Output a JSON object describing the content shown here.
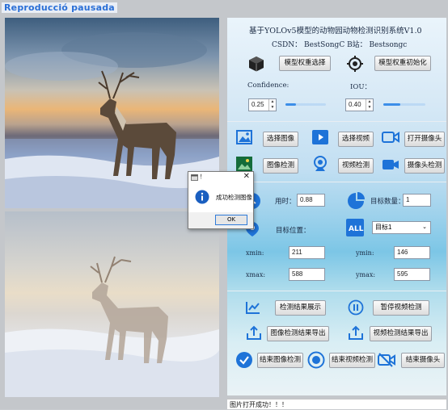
{
  "window": {
    "title": "Reproducció pausada"
  },
  "header": {
    "app_title": "基于YOLOv5模型的动物园动物检测识别系统V1.0",
    "csdn": "CSDN：  BestSongC   B站： Bestsongc"
  },
  "model": {
    "select_label": "模型权重选择",
    "init_label": "模型权重初始化"
  },
  "params": {
    "confidence_label": "Confidence:",
    "confidence_value": "0.25",
    "confidence_level": 0.25,
    "iou_label": "IOU：",
    "iou_value": "0.40",
    "iou_level": 0.4
  },
  "actions": {
    "select_image": "选择图像",
    "select_video": "选择视频",
    "open_camera": "打开摄像头",
    "image_detect": "图像检测",
    "video_detect": "视频检测",
    "camera_detect": "摄像头检测"
  },
  "results": {
    "time_label": "用时：",
    "time_value": "0.88",
    "count_label": "目标数量：",
    "count_value": "1",
    "position_label": "目标位置：",
    "target_select": "目标1",
    "xmin_label": "xmin:",
    "xmin_value": "211",
    "ymin_label": "ymin:",
    "ymin_value": "146",
    "xmax_label": "xmax:",
    "xmax_value": "588",
    "ymax_label": "ymax:",
    "ymax_value": "595"
  },
  "bottom": {
    "show_result": "检测结果展示",
    "pause_video": "暂停视频检测",
    "export_image": "图像检测结果导出",
    "export_video": "视频检测结果导出",
    "end_image": "结束图像检测",
    "end_video": "结束视频检测",
    "end_camera": "结束摄像头"
  },
  "status": {
    "text": "图片打开成功！！！"
  },
  "dialog": {
    "title": "！",
    "message": "成功检测图像",
    "ok": "OK"
  },
  "colors": {
    "accent": "#2f7bd9",
    "icon_blue": "#1e73d8",
    "panel_bg": "#c2dff2"
  }
}
